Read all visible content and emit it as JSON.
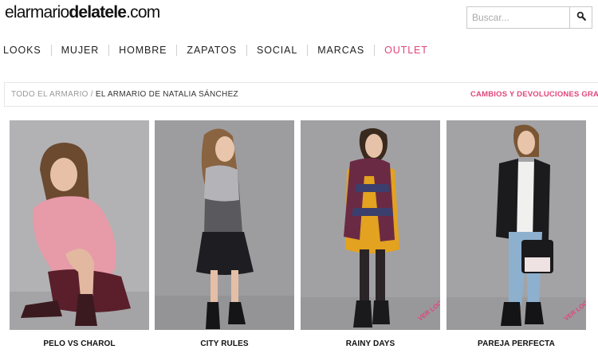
{
  "brand": {
    "logo_light": "elarmario",
    "logo_bold": "delatele",
    "logo_suffix": ".com"
  },
  "search": {
    "placeholder": "Buscar...",
    "icon": "search-icon"
  },
  "nav": {
    "items": [
      {
        "label": "LOOKS"
      },
      {
        "label": "MUJER"
      },
      {
        "label": "HOMBRE"
      },
      {
        "label": "ZAPATOS"
      },
      {
        "label": "SOCIAL"
      },
      {
        "label": "MARCAS"
      },
      {
        "label": "OUTLET"
      }
    ],
    "outlet_color": "#e0457b"
  },
  "breadcrumb": {
    "root": "TODO EL ARMARIO",
    "separator": "/",
    "current": "EL ARMARIO DE NATALIA SÁNCHEZ"
  },
  "returns_link": "CAMBIOS Y DEVOLUCIONES GRATIS",
  "looks": [
    {
      "title": "PELO VS CHAROL"
    },
    {
      "title": "CITY RULES"
    },
    {
      "title": "RAINY DAYS",
      "badge": "VER LOOK"
    },
    {
      "title": "PAREJA PERFECTA",
      "badge": "VER LOOK"
    }
  ],
  "colors": {
    "accent": "#e0457b",
    "photo_bg": "#a7a7a9"
  }
}
